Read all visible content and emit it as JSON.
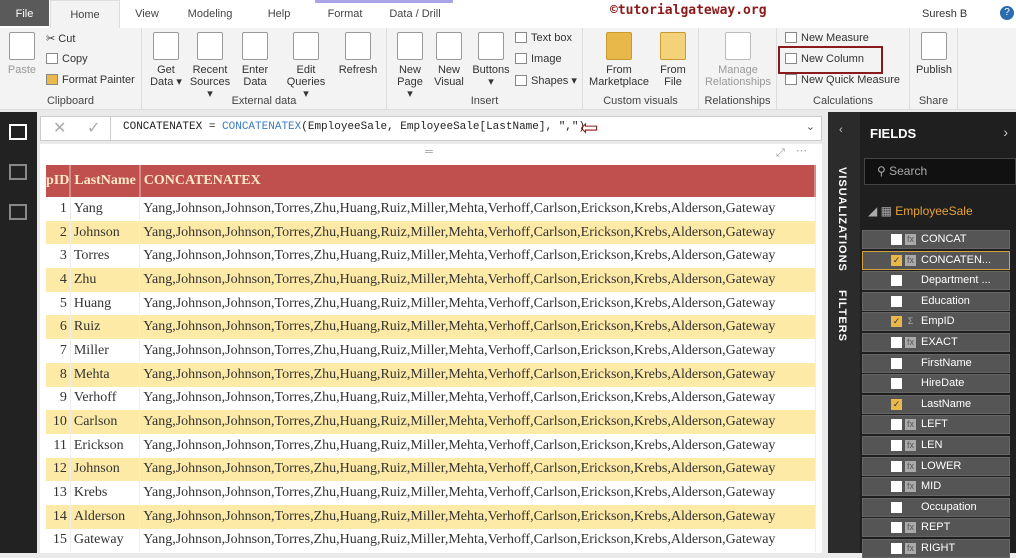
{
  "tabs": [
    "File",
    "Home",
    "View",
    "Modeling",
    "Help",
    "Format",
    "Data / Drill"
  ],
  "watermark": "©tutorialgateway.org",
  "user": "Suresh B",
  "help": "?",
  "ribbon": {
    "clipboard": {
      "paste": "Paste",
      "cut": "Cut",
      "copy": "Copy",
      "format_painter": "Format Painter",
      "label": "Clipboard"
    },
    "external": {
      "get_data": "Get Data ▾",
      "recent": "Recent Sources ▾",
      "enter": "Enter Data",
      "edit": "Edit Queries ▾",
      "refresh": "Refresh",
      "label": "External data"
    },
    "insert": {
      "new_page": "New Page ▾",
      "new_visual": "New Visual",
      "buttons": "Buttons ▾",
      "text_box": "Text box",
      "image": "Image",
      "shapes": "Shapes ▾",
      "label": "Insert"
    },
    "custom": {
      "marketplace": "From Marketplace",
      "file": "From File",
      "label": "Custom visuals"
    },
    "relationships": {
      "manage": "Manage Relationships",
      "label": "Relationships"
    },
    "calculations": {
      "new_measure": "New Measure",
      "new_column": "New Column",
      "new_quick": "New Quick Measure",
      "label": "Calculations"
    },
    "share": {
      "publish": "Publish",
      "label": "Share"
    }
  },
  "formula": {
    "name": "CONCATENATEX = ",
    "fn": "CONCATENATEX",
    "args": "(EmployeeSale, EmployeeSale[LastName], \",\")"
  },
  "table": {
    "headers": [
      "pID",
      "LastName",
      "CONCATENATEX"
    ],
    "concat": "Yang,Johnson,Johnson,Torres,Zhu,Huang,Ruiz,Miller,Mehta,Verhoff,Carlson,Erickson,Krebs,Alderson,Gateway",
    "rows": [
      [
        "1",
        "Yang"
      ],
      [
        "2",
        "Johnson"
      ],
      [
        "3",
        "Torres"
      ],
      [
        "4",
        "Zhu"
      ],
      [
        "5",
        "Huang"
      ],
      [
        "6",
        "Ruiz"
      ],
      [
        "7",
        "Miller"
      ],
      [
        "8",
        "Mehta"
      ],
      [
        "9",
        "Verhoff"
      ],
      [
        "10",
        "Carlson"
      ],
      [
        "11",
        "Erickson"
      ],
      [
        "12",
        "Johnson"
      ],
      [
        "13",
        "Krebs"
      ],
      [
        "14",
        "Alderson"
      ],
      [
        "15",
        "Gateway"
      ]
    ]
  },
  "panes": {
    "visualizations": "VISUALIZATIONS",
    "filters": "FILTERS"
  },
  "fields": {
    "title": "FIELDS",
    "search_placeholder": "Search",
    "table": "EmployeeSale",
    "items": [
      {
        "name": "CONCAT",
        "checked": false,
        "icon": "calc"
      },
      {
        "name": "CONCATEN...",
        "checked": true,
        "icon": "calc",
        "selected": true
      },
      {
        "name": "Department ...",
        "checked": false,
        "icon": ""
      },
      {
        "name": "Education",
        "checked": false,
        "icon": ""
      },
      {
        "name": "EmpID",
        "checked": true,
        "icon": "sigma"
      },
      {
        "name": "EXACT",
        "checked": false,
        "icon": "calc"
      },
      {
        "name": "FirstName",
        "checked": false,
        "icon": ""
      },
      {
        "name": "HireDate",
        "checked": false,
        "icon": ""
      },
      {
        "name": "LastName",
        "checked": true,
        "icon": ""
      },
      {
        "name": "LEFT",
        "checked": false,
        "icon": "calc"
      },
      {
        "name": "LEN",
        "checked": false,
        "icon": "calc"
      },
      {
        "name": "LOWER",
        "checked": false,
        "icon": "calc"
      },
      {
        "name": "MID",
        "checked": false,
        "icon": "calc"
      },
      {
        "name": "Occupation",
        "checked": false,
        "icon": ""
      },
      {
        "name": "REPT",
        "checked": false,
        "icon": "calc"
      },
      {
        "name": "RIGHT",
        "checked": false,
        "icon": "calc"
      }
    ]
  }
}
